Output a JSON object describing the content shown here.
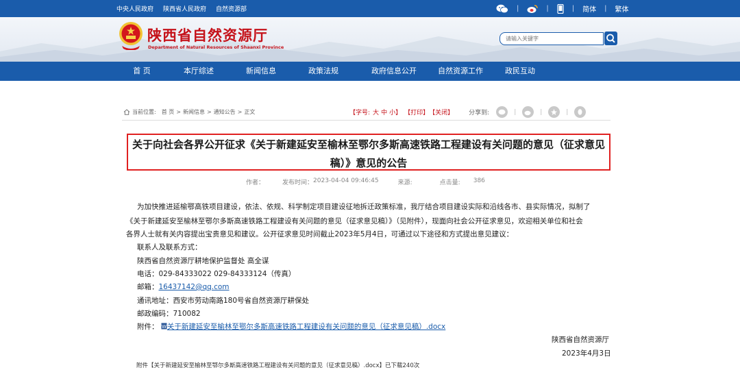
{
  "topbar": {
    "links": [
      "中央人民政府",
      "陕西省人民政府",
      "自然资源部"
    ],
    "lang_simplified": "简体",
    "lang_traditional": "繁体",
    "social_icons": [
      "wechat-icon",
      "weibo-icon",
      "mobile-icon"
    ]
  },
  "header": {
    "site_title": "陕西省自然资源厅",
    "site_subtitle": "Department of Natural Resources of Shaanxi Province",
    "search_placeholder": "请输入关键字",
    "brand_red": "#c5121a",
    "brand_blue": "#1a5cab"
  },
  "nav": {
    "items": [
      "首 页",
      "本厅综述",
      "新闻信息",
      "政策法规",
      "政府信息公开",
      "自然资源工作",
      "政民互动"
    ]
  },
  "breadcrumb": {
    "label": "当前位置:",
    "items": [
      "首 页",
      "新闻信息",
      "通知公告",
      "正文"
    ],
    "separator": ">"
  },
  "tools": {
    "font_label": "【字号:",
    "font_sizes": [
      "大",
      "中",
      "小"
    ],
    "font_close": "】",
    "print": "【打印】",
    "close": "【关闭】",
    "share_label": "分享到:"
  },
  "article": {
    "title_line1": "关于向社会各界公开征求《关于新建延安至榆林至鄂尔多斯高速铁路工程建设有关问题的意见（征求意见",
    "title_line2": "稿）》意见的公告",
    "author_label": "作者：",
    "publish_label": "发布时间：",
    "publish_time": "2023-04-04 09:46:45",
    "source_label": "来源:",
    "clicks_label": "点击量:",
    "clicks": "386",
    "paragraph_lines": [
      "为加快推进延榆鄂高铁项目建设，依法、依规、科学制定项目建设征地拆迁政策标准，我厅结合项目建设实际和沿线各市、县实际情况，拟制了",
      "《关于新建延安至榆林至鄂尔多斯高速铁路工程建设有关问题的意见（征求意见稿）》（见附件），现面向社会公开征求意见，欢迎相关单位和社会",
      "各界人士就有关内容提出宝贵意见和建议。公开征求意见时间截止2023年5月4日，可通过以下途径和方式提出意见建议："
    ],
    "contact_heading": "联系人及联系方式：",
    "contact_person": "陕西省自然资源厅耕地保护监督处 高全谋",
    "phone": "电话：029-84333022 029-84333124（传真）",
    "email_label": "邮箱：",
    "email": "16437142@qq.com",
    "address": "通讯地址：西安市劳动南路180号省自然资源厅耕保处",
    "postcode": "邮政编码：710082",
    "attachment_label": "附件：",
    "attachment_link": "关于新建延安至榆林至鄂尔多斯高速铁路工程建设有关问题的意见（征求意见稿）.docx",
    "signature_org": "陕西省自然资源厅",
    "signature_date": "2023年4月3日",
    "download_note": "附件【关于新建延安至榆林至鄂尔多斯高速铁路工程建设有关问题的意见（征求意见稿）.docx】已下载240次"
  }
}
